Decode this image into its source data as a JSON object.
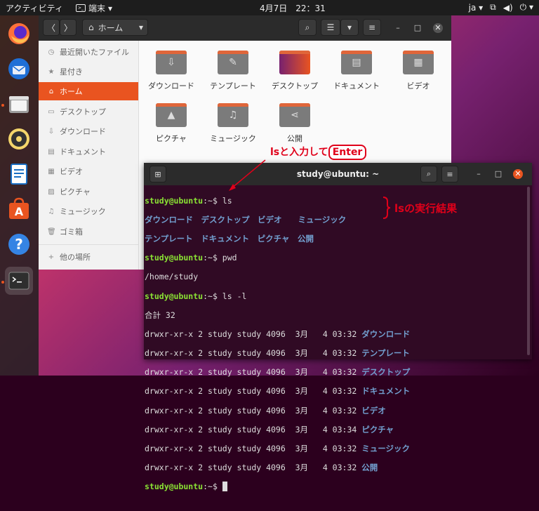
{
  "topbar": {
    "activities": "アクティビティ",
    "app_name": "端末",
    "clock": "4月7日　22：31",
    "lang": "ja"
  },
  "dock": {
    "items": [
      {
        "name": "firefox-icon"
      },
      {
        "name": "thunderbird-icon"
      },
      {
        "name": "files-icon"
      },
      {
        "name": "rhythmbox-icon"
      },
      {
        "name": "libreoffice-writer-icon"
      },
      {
        "name": "software-center-icon"
      },
      {
        "name": "help-icon"
      },
      {
        "name": "terminal-icon"
      }
    ]
  },
  "files": {
    "location": "ホーム",
    "sidebar": [
      {
        "label": "最近開いたファイル",
        "icon": "◷"
      },
      {
        "label": "星付き",
        "icon": "★"
      },
      {
        "label": "ホーム",
        "icon": "⌂"
      },
      {
        "label": "デスクトップ",
        "icon": "▭"
      },
      {
        "label": "ダウンロード",
        "icon": "⇩"
      },
      {
        "label": "ドキュメント",
        "icon": "▤"
      },
      {
        "label": "ビデオ",
        "icon": "▦"
      },
      {
        "label": "ピクチャ",
        "icon": "▨"
      },
      {
        "label": "ミュージック",
        "icon": "♫"
      },
      {
        "label": "ゴミ箱",
        "icon": "🗑"
      },
      {
        "label": "他の場所",
        "icon": "+"
      }
    ],
    "folders": [
      {
        "label": "ダウンロード",
        "glyph": "⇩"
      },
      {
        "label": "テンプレート",
        "glyph": "✎"
      },
      {
        "label": "デスクトップ",
        "glyph": ""
      },
      {
        "label": "ドキュメント",
        "glyph": "▤"
      },
      {
        "label": "ビデオ",
        "glyph": "▦"
      },
      {
        "label": "ピクチャ",
        "glyph": "▲"
      },
      {
        "label": "ミュージック",
        "glyph": "♫"
      },
      {
        "label": "公開",
        "glyph": "⋖"
      }
    ]
  },
  "terminal": {
    "title": "study@ubuntu: ~",
    "prompt_user": "study@ubuntu",
    "prompt_sep": ":~$ ",
    "cmd1": "ls",
    "ls_row1": "ダウンロード　デスクトップ　ビデオ　　ミュージック",
    "ls_row2": "テンプレート　ドキュメント　ピクチャ　公開",
    "cmd2": "pwd",
    "pwd_out": "/home/study",
    "cmd3": "ls -l",
    "total": "合計 32",
    "entries": [
      {
        "meta": "drwxr-xr-x 2 study study 4096  3月   4 03:32 ",
        "name": "ダウンロード"
      },
      {
        "meta": "drwxr-xr-x 2 study study 4096  3月   4 03:32 ",
        "name": "テンプレート"
      },
      {
        "meta": "drwxr-xr-x 2 study study 4096  3月   4 03:32 ",
        "name": "デスクトップ"
      },
      {
        "meta": "drwxr-xr-x 2 study study 4096  3月   4 03:32 ",
        "name": "ドキュメント"
      },
      {
        "meta": "drwxr-xr-x 2 study study 4096  3月   4 03:32 ",
        "name": "ビデオ"
      },
      {
        "meta": "drwxr-xr-x 2 study study 4096  3月   4 03:34 ",
        "name": "ピクチャ"
      },
      {
        "meta": "drwxr-xr-x 2 study study 4096  3月   4 03:32 ",
        "name": "ミュージック"
      },
      {
        "meta": "drwxr-xr-x 2 study study 4096  3月   4 03:32 ",
        "name": "公開"
      }
    ]
  },
  "annotations": {
    "enter_prefix": "lsと入力して",
    "enter_key": "Enter",
    "result": "lsの実行結果"
  },
  "colors": {
    "accent": "#e95420",
    "prompt": "#8ae234",
    "dir": "#729fcf",
    "terminal_bg": "#300a24",
    "annotation": "#e0001a"
  }
}
